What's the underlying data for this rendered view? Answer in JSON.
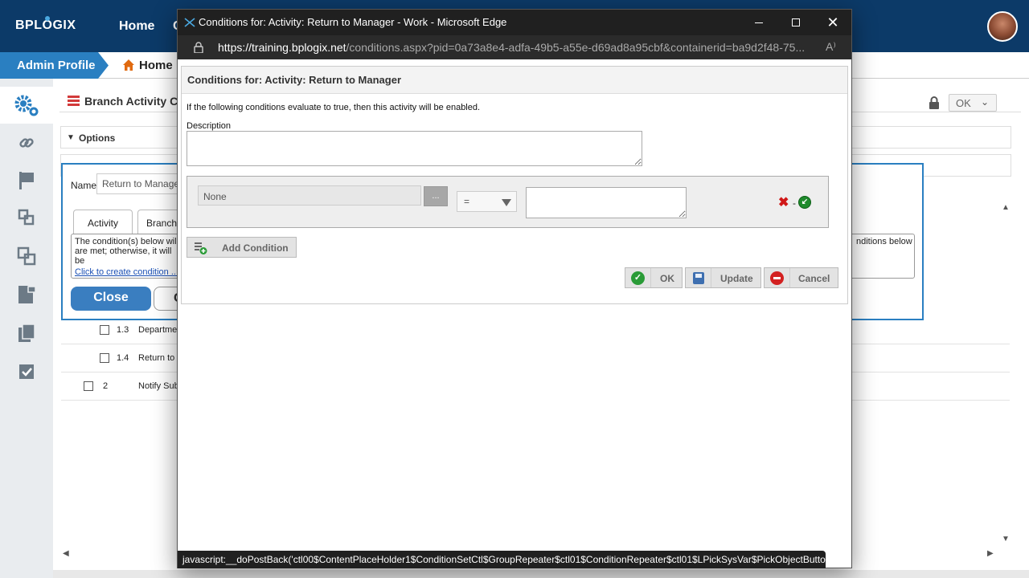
{
  "app": {
    "logo": "BPLOGIX",
    "nav_home": "Home",
    "nav_partial": "C",
    "breadcrumb_admin": "Admin Profile",
    "breadcrumb_home": "Home",
    "panel_title": "Branch Activity Con",
    "ok_select": "OK",
    "options_label": "Options",
    "name_label": "Name",
    "name_value": "Return to Manage",
    "tabs": [
      "Activity",
      "Branch"
    ],
    "cond_text": "The condition(s) below will are met; otherwise, it will be",
    "cond_text_right": "nditions below",
    "create_condition_link": "Click to create condition ...",
    "close_button": "Close",
    "other_button": "C",
    "tree": [
      {
        "num": "1.3",
        "label": "Departmen"
      },
      {
        "num": "1.4",
        "label": "Return to"
      },
      {
        "num": "2",
        "label": "Notify Sub"
      }
    ]
  },
  "popup": {
    "window_title": "Conditions for: Activity: Return to Manager - Work - Microsoft Edge",
    "url_host": "https://training.bplogix.net",
    "url_path": "/conditions.aspx?pid=0a73a8e4-adfa-49b5-a55e-d69ad8a95cbf&containerid=ba9d2f48-75...",
    "dialog_title": "Conditions for: Activity: Return to Manager",
    "intro_text": "If the following conditions evaluate to true, then this activity will be enabled.",
    "description_label": "Description",
    "variable_value": "None",
    "pick_button": "...",
    "operator_value": "=",
    "add_condition_label": "Add Condition",
    "ok_label": "OK",
    "update_label": "Update",
    "cancel_label": "Cancel",
    "status_text": "javascript:__doPostBack('ctl00$ContentPlaceHolder1$ConditionSetCtl$GroupRepeater$ctl01$ConditionRepeater$ctl01$LPickSysVar$PickObjectButton..."
  },
  "colors": {
    "topbar": "#0c3a68",
    "accent": "#2a7fc1",
    "popup_chrome": "#202020",
    "delete_red": "#d01818",
    "ok_green": "#2a9b37"
  }
}
